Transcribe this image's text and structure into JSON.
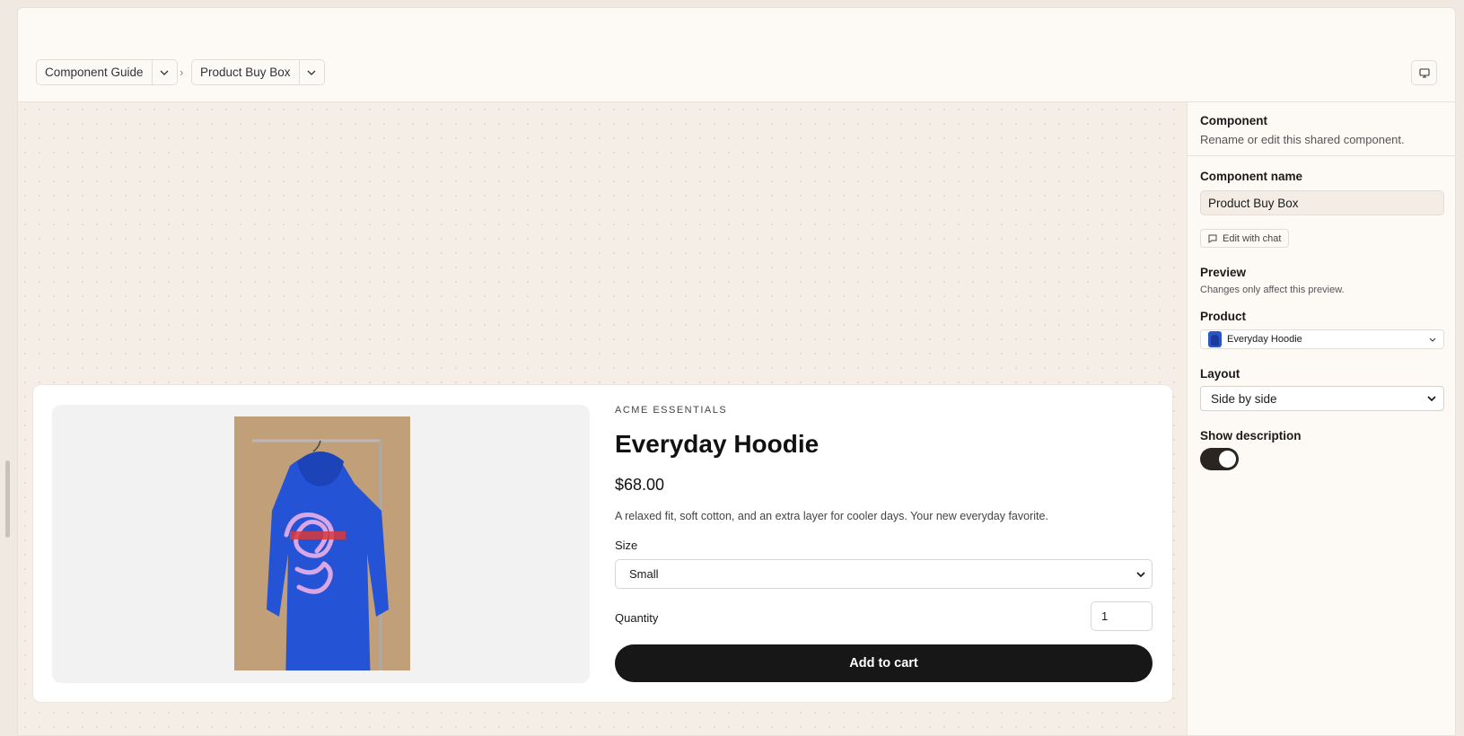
{
  "breadcrumb": {
    "items": [
      {
        "label": "Component Guide"
      },
      {
        "label": "Product Buy Box"
      }
    ],
    "separator": "›"
  },
  "icons": {
    "chevron": "chevron-down-icon",
    "device": "desktop-icon",
    "chat": "chat-bubble-icon"
  },
  "panel": {
    "header_title": "Component",
    "header_sub": "Rename or edit this shared component.",
    "name_label": "Component name",
    "name_value": "Product Buy Box",
    "edit_chat_label": "Edit with chat",
    "preview_title": "Preview",
    "preview_sub": "Changes only affect this preview.",
    "product_label": "Product",
    "product_value": "Everyday Hoodie",
    "layout_label": "Layout",
    "layout_value": "Side by side",
    "show_desc_label": "Show description",
    "show_desc_on": true
  },
  "product": {
    "brand": "ACME ESSENTIALS",
    "title": "Everyday Hoodie",
    "price": "$68.00",
    "description": "A relaxed fit, soft cotton, and an extra layer for cooler days. Your new everyday favorite.",
    "size_label": "Size",
    "size_value": "Small",
    "quantity_label": "Quantity",
    "quantity_value": "1",
    "cta": "Add to cart"
  },
  "colors": {
    "accent_dark": "#171717",
    "hoodie_blue": "#2453d6",
    "canvas_bg": "#f4eee7"
  }
}
